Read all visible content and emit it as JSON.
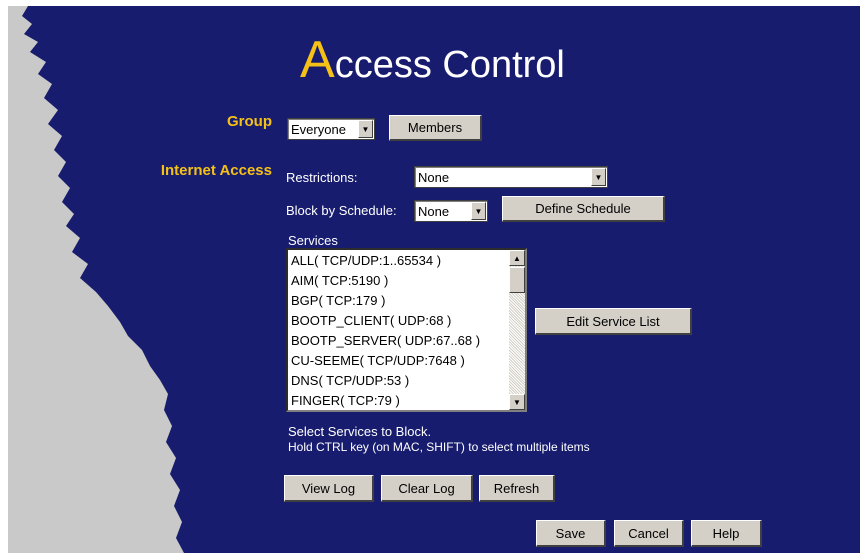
{
  "page": {
    "title_initial": "A",
    "title_rest": "ccess Control"
  },
  "group": {
    "label": "Group",
    "selected": "Everyone",
    "members_button": "Members"
  },
  "internet_access": {
    "label": "Internet Access",
    "restrictions_label": "Restrictions:",
    "restrictions_value": "None",
    "schedule_label": "Block by Schedule:",
    "schedule_value": "None",
    "define_schedule_button": "Define Schedule",
    "services_label": "Services",
    "services": [
      "ALL( TCP/UDP:1..65534 )",
      "AIM( TCP:5190 )",
      "BGP( TCP:179 )",
      "BOOTP_CLIENT( UDP:68 )",
      "BOOTP_SERVER( UDP:67..68 )",
      "CU-SEEME( TCP/UDP:7648 )",
      "DNS( TCP/UDP:53 )",
      "FINGER( TCP:79 )"
    ],
    "edit_service_list_button": "Edit Service List",
    "hint_line1": "Select Services to Block.",
    "hint_line2": "Hold CTRL key (on MAC, SHIFT) to select multiple items"
  },
  "log_buttons": {
    "view_log": "View Log",
    "clear_log": "Clear Log",
    "refresh": "Refresh"
  },
  "footer_buttons": {
    "save": "Save",
    "cancel": "Cancel",
    "help": "Help"
  },
  "colors": {
    "background": "#171c6e",
    "accent": "#f5c116",
    "edge": "#c9c9c9"
  }
}
